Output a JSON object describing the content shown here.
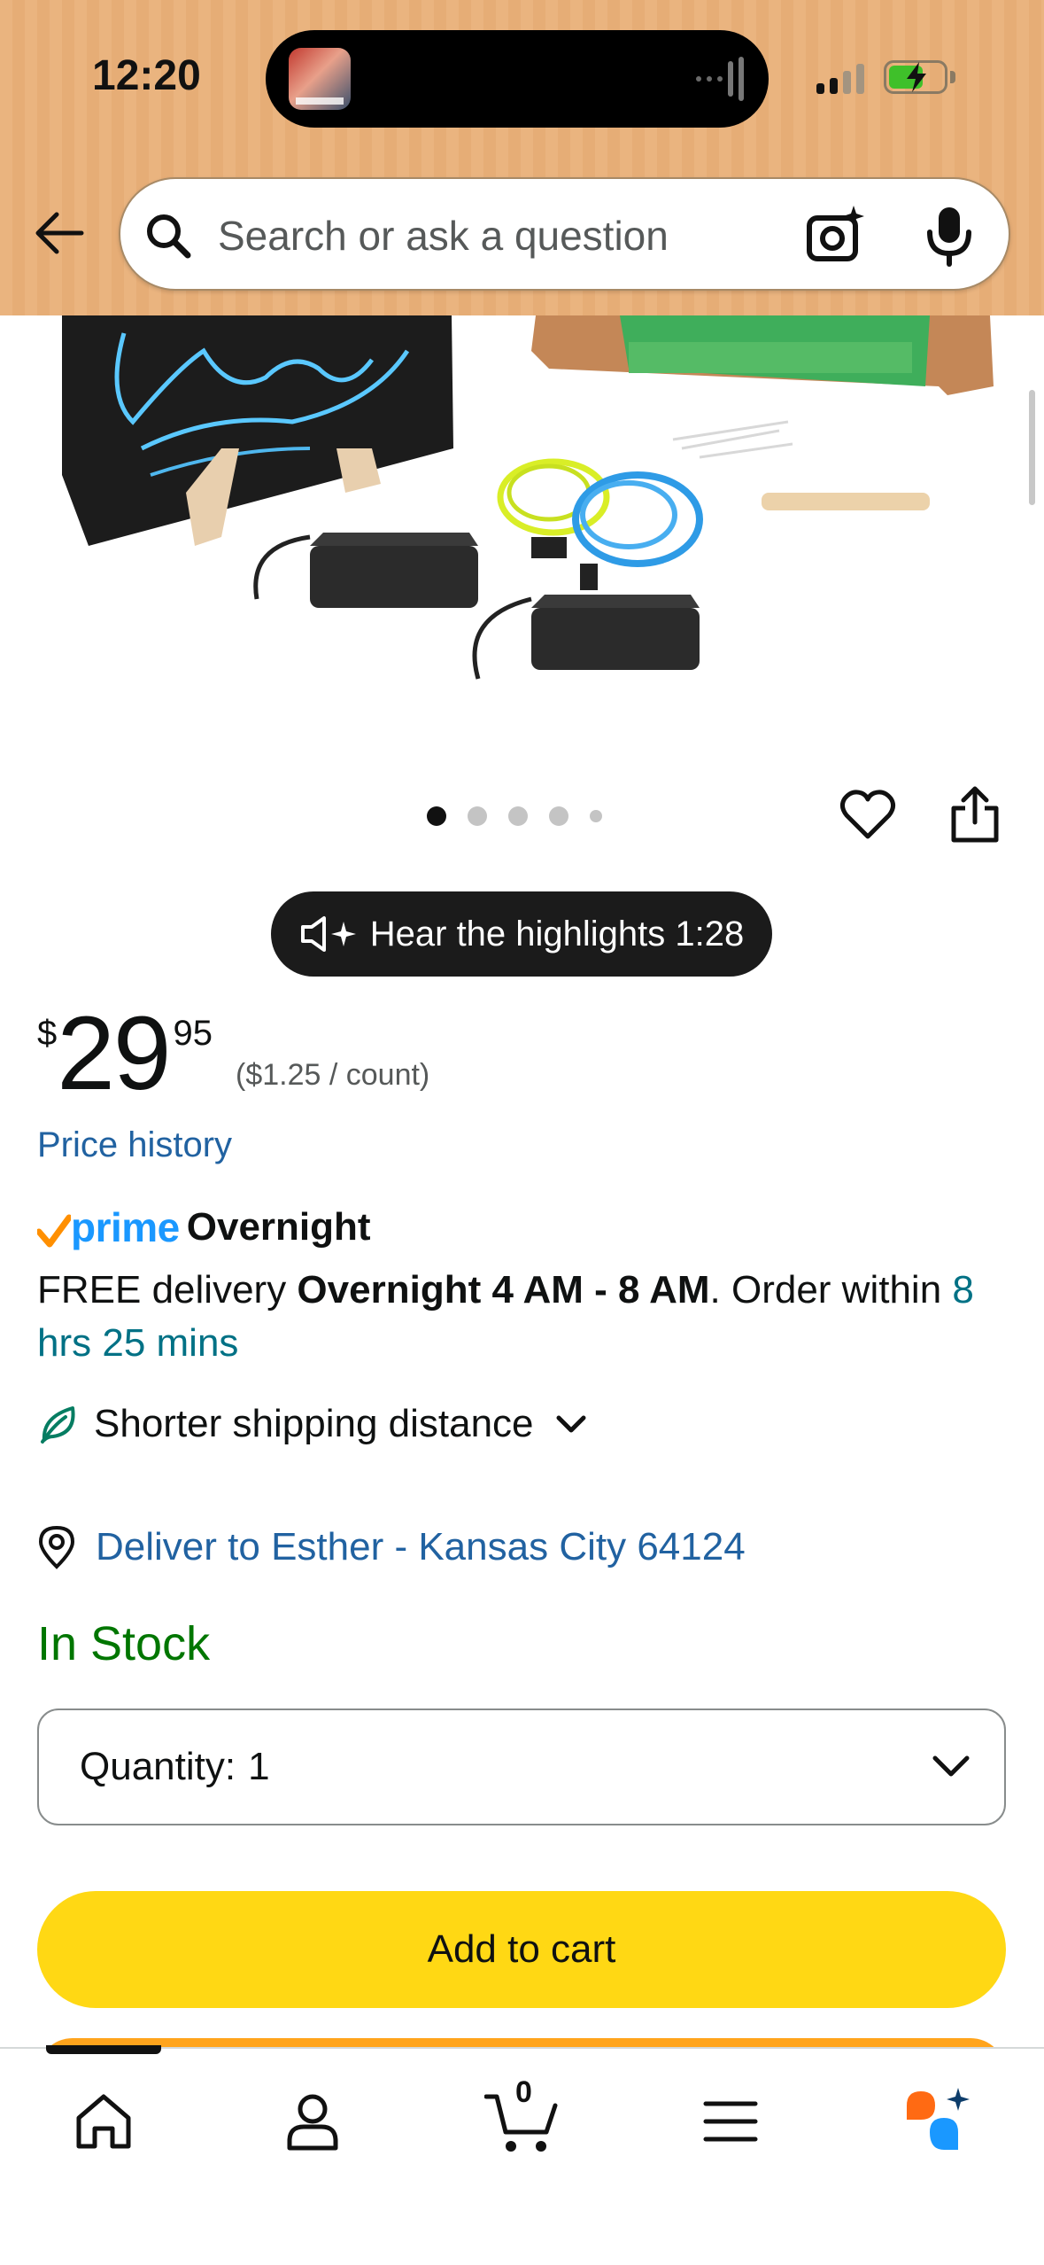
{
  "status_bar": {
    "time": "12:20",
    "now_playing_icon": "music-album-art",
    "signal_strength_bars": 2,
    "battery_charging": true
  },
  "header": {
    "back_icon": "arrow-left-icon",
    "search": {
      "placeholder": "Search or ask a question",
      "value": ""
    },
    "camera_icon": "camera-sparkle-icon",
    "mic_icon": "microphone-icon",
    "background_color": "#eab47f"
  },
  "product_image": {
    "description_icon": "el-wire-kit-photo",
    "carousel_total": 5,
    "carousel_active_index": 0
  },
  "actions": {
    "wishlist_icon": "heart-icon",
    "share_icon": "share-icon"
  },
  "highlights": {
    "label": "Hear the highlights 1:28",
    "icon": "speaker-sparkle-icon"
  },
  "price": {
    "symbol": "$",
    "whole": "29",
    "fraction": "95",
    "unit_price": "($1.25 / count)",
    "history_link": "Price history"
  },
  "prime": {
    "brand": "prime",
    "service": "Overnight"
  },
  "delivery": {
    "prefix": "FREE delivery ",
    "window": "Overnight 4 AM - 8 AM",
    "middle": ". Order within ",
    "countdown": "8 hrs 25 mins"
  },
  "shipping": {
    "label": "Shorter shipping distance"
  },
  "deliver_to": {
    "label": "Deliver to Esther - Kansas City 64124"
  },
  "stock": {
    "status": "In Stock",
    "color": "#007600"
  },
  "quantity": {
    "label": "Quantity:",
    "value": "1"
  },
  "buttons": {
    "add_to_cart": "Add to cart",
    "add_to_cart_color": "#ffd814",
    "buy_now_color": "#ffa41c"
  },
  "bottom_nav": {
    "items": [
      {
        "name": "home",
        "icon": "home-icon"
      },
      {
        "name": "account",
        "icon": "person-icon"
      },
      {
        "name": "cart",
        "icon": "cart-icon"
      },
      {
        "name": "menu",
        "icon": "hamburger-icon"
      },
      {
        "name": "rufus",
        "icon": "rufus-ai-icon"
      }
    ],
    "cart_count": "0",
    "active_index": 0
  },
  "colors": {
    "link": "#2162a1",
    "teal": "#007185",
    "prime_blue": "#1a98ff"
  }
}
